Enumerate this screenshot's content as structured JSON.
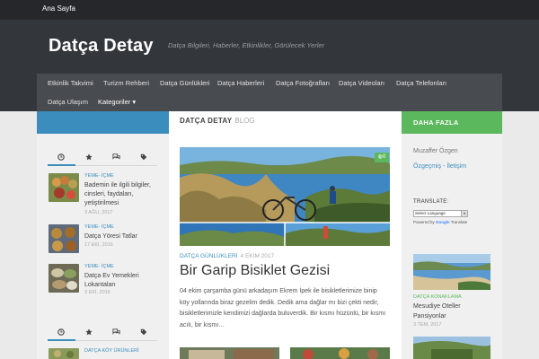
{
  "topbar": {
    "home_link": "Ana Sayfa"
  },
  "site": {
    "title": "Datça Detay",
    "tagline": "Datça Bilgileri, Haberler, Etkinlikler, Görülecek Yerler"
  },
  "nav": {
    "row1": [
      "Etkinlik Takvimi",
      "Turizm Rehberi",
      "Datça Günlükleri",
      "Datça Haberleri",
      "Datça Fotoğrafları",
      "Datça Videoları",
      "Datça Telefonları"
    ],
    "row2": [
      "Datça Ulaşım",
      "Kategoriler ▾"
    ]
  },
  "left_sidebar": {
    "tab_icons": [
      "clock-icon",
      "star-icon",
      "comments-icon",
      "tags-icon"
    ],
    "posts": [
      {
        "category": "YEME- İÇME",
        "title": "Bademin ile ilgili bilgiler, cinsleri, faydaları, yetiştirilmesi",
        "date": "3 AĞU, 2017"
      },
      {
        "category": "YEME- İÇME",
        "title": "Datça Yöresi Tatlar",
        "date": "17 EKİ, 2016"
      },
      {
        "category": "YEME- İÇME",
        "title": "Datça Ev Yemekleri Lokantaları",
        "date": "3 EKİ, 2016"
      }
    ],
    "second_widget": {
      "category": "DATÇA KÖY ÜRÜNLERİ"
    }
  },
  "main": {
    "heading": "DATÇA DETAY",
    "subheading": "BLOG",
    "post": {
      "comment_count": "0",
      "category": "DATÇA GÜNLÜKLERİ",
      "date": "4 EKİM 2017",
      "title": "Bir Garip Bisiklet Gezisi",
      "excerpt": "04 ekim çarşamba günü arkadaşım Ekrem İpek ile bisikletlerimize binip köy yollarında biraz gezelim dedik. Dedik ama dağlar mı bizi çekti nedir, bisikletlerimizle kendimizi dağlarda buluverdik. Bir kısmı hüzünlü, bir kısmı acılı, bir kısmı…"
    }
  },
  "right_sidebar": {
    "heading": "DAHA FAZLA",
    "author": "Muzaffer Özgen",
    "links": "Özgeçmiş - İletişim",
    "translate_label": "TRANSLATE:",
    "select_language": "Select Language",
    "powered_by": "Powered by",
    "google": "Google",
    "translate": "Translate",
    "post": {
      "category": "DATÇA KONAKLAMA",
      "title": "Mesudiye Oteller Pansiyonlar",
      "date": "3 TEM, 2017"
    }
  },
  "colors": {
    "blue": "#3b8dbd",
    "green": "#5cb85c",
    "header": "#33363b",
    "topbar": "#26272b"
  }
}
